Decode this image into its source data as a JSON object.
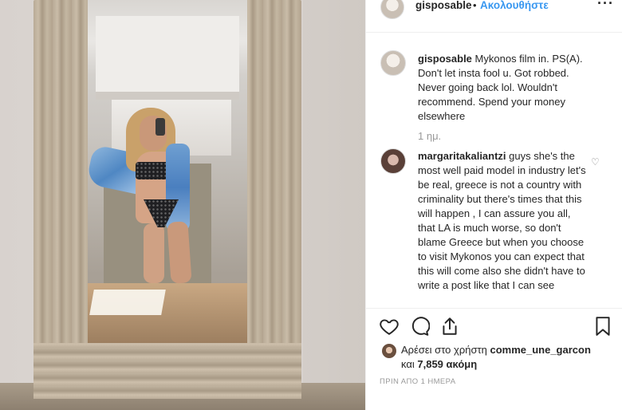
{
  "header": {
    "username": "gisposable",
    "separator": "•",
    "follow_label": "Ακολουθήστε",
    "more_icon": "more-options-icon"
  },
  "caption": {
    "username": "gisposable",
    "text": "Mykonos film in. PS(A). Don't let insta fool u. Got robbed. Never going back lol. Wouldn't recommend. Spend your money elsewhere",
    "time": "1 ημ."
  },
  "comment": {
    "username": "margaritakaliantzi",
    "text": "guys she's the most well paid model in industry let's be real, greece is not a country with criminality but there's times that this will happen , I can assure you all, that LA is much worse, so don't blame Greece but when you choose to visit Mykonos you can expect that this will come also she didn't have to write a post like that I can see"
  },
  "actions": {
    "like_icon": "heart-icon",
    "comment_icon": "comment-icon",
    "share_icon": "share-icon",
    "save_icon": "bookmark-icon"
  },
  "likes": {
    "prefix": "Αρέσει στο χρήστη",
    "liker": "comme_une_garcon",
    "and": "και",
    "others": "7,859 ακόμη"
  },
  "date": "ΠΡΙΝ ΑΠΟ 1 ΗΜΕΡΑ",
  "colors": {
    "accent": "#3897f0",
    "text": "#262626",
    "muted": "#999999"
  }
}
